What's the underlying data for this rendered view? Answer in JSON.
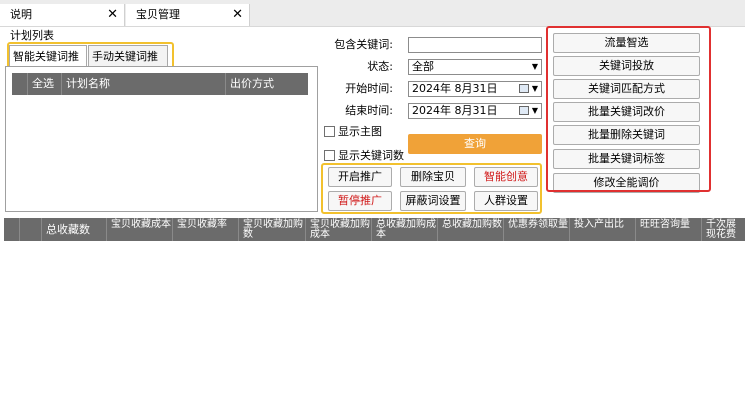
{
  "tabs": [
    {
      "label": "说明",
      "close": "✕"
    },
    {
      "label": "宝贝管理",
      "close": "✕"
    }
  ],
  "plan_list": {
    "group_label": "计划列表",
    "tabs": [
      "智能关键词推广",
      "手动关键词推广"
    ],
    "columns": [
      "全选",
      "计划名称",
      "出价方式"
    ]
  },
  "filters": {
    "keyword_label": "包含关键词:",
    "keyword_value": "",
    "status_label": "状态:",
    "status_value": "全部",
    "start_label": "开始时间:",
    "start_value": "2024年  8月31日",
    "end_label": "结束时间:",
    "end_value": "2024年  8月31日",
    "show_main_image": "显示主图",
    "show_keywords": "显示关键词数",
    "query_button": "查询"
  },
  "action_buttons": {
    "start_promo": "开启推广",
    "delete_item": "删除宝贝",
    "smart_creative": "智能创意",
    "pause_promo": "暂停推广",
    "block_words": "屏蔽词设置",
    "crowd_settings": "人群设置"
  },
  "side_buttons": [
    "流量智选",
    "关键词投放",
    "关键词匹配方式",
    "批量关键词改价",
    "批量删除关键词",
    "批量关键词标签",
    "修改全能调价"
  ],
  "results": {
    "columns": [
      "总收藏数",
      "宝贝收藏成本",
      "宝贝收藏率",
      "宝贝收藏加购数",
      "宝贝收藏加购成本",
      "总收藏加购成本",
      "总收藏加购数",
      "优惠券领取量",
      "投入产出比",
      "旺旺咨询量",
      "千次展现花费"
    ]
  },
  "colors": {
    "header_gray": "#6b6b6b",
    "query_orange": "#f0a238",
    "highlight_yellow": "#f2c12e",
    "highlight_red": "#e03030",
    "danger_text": "#d01818"
  }
}
